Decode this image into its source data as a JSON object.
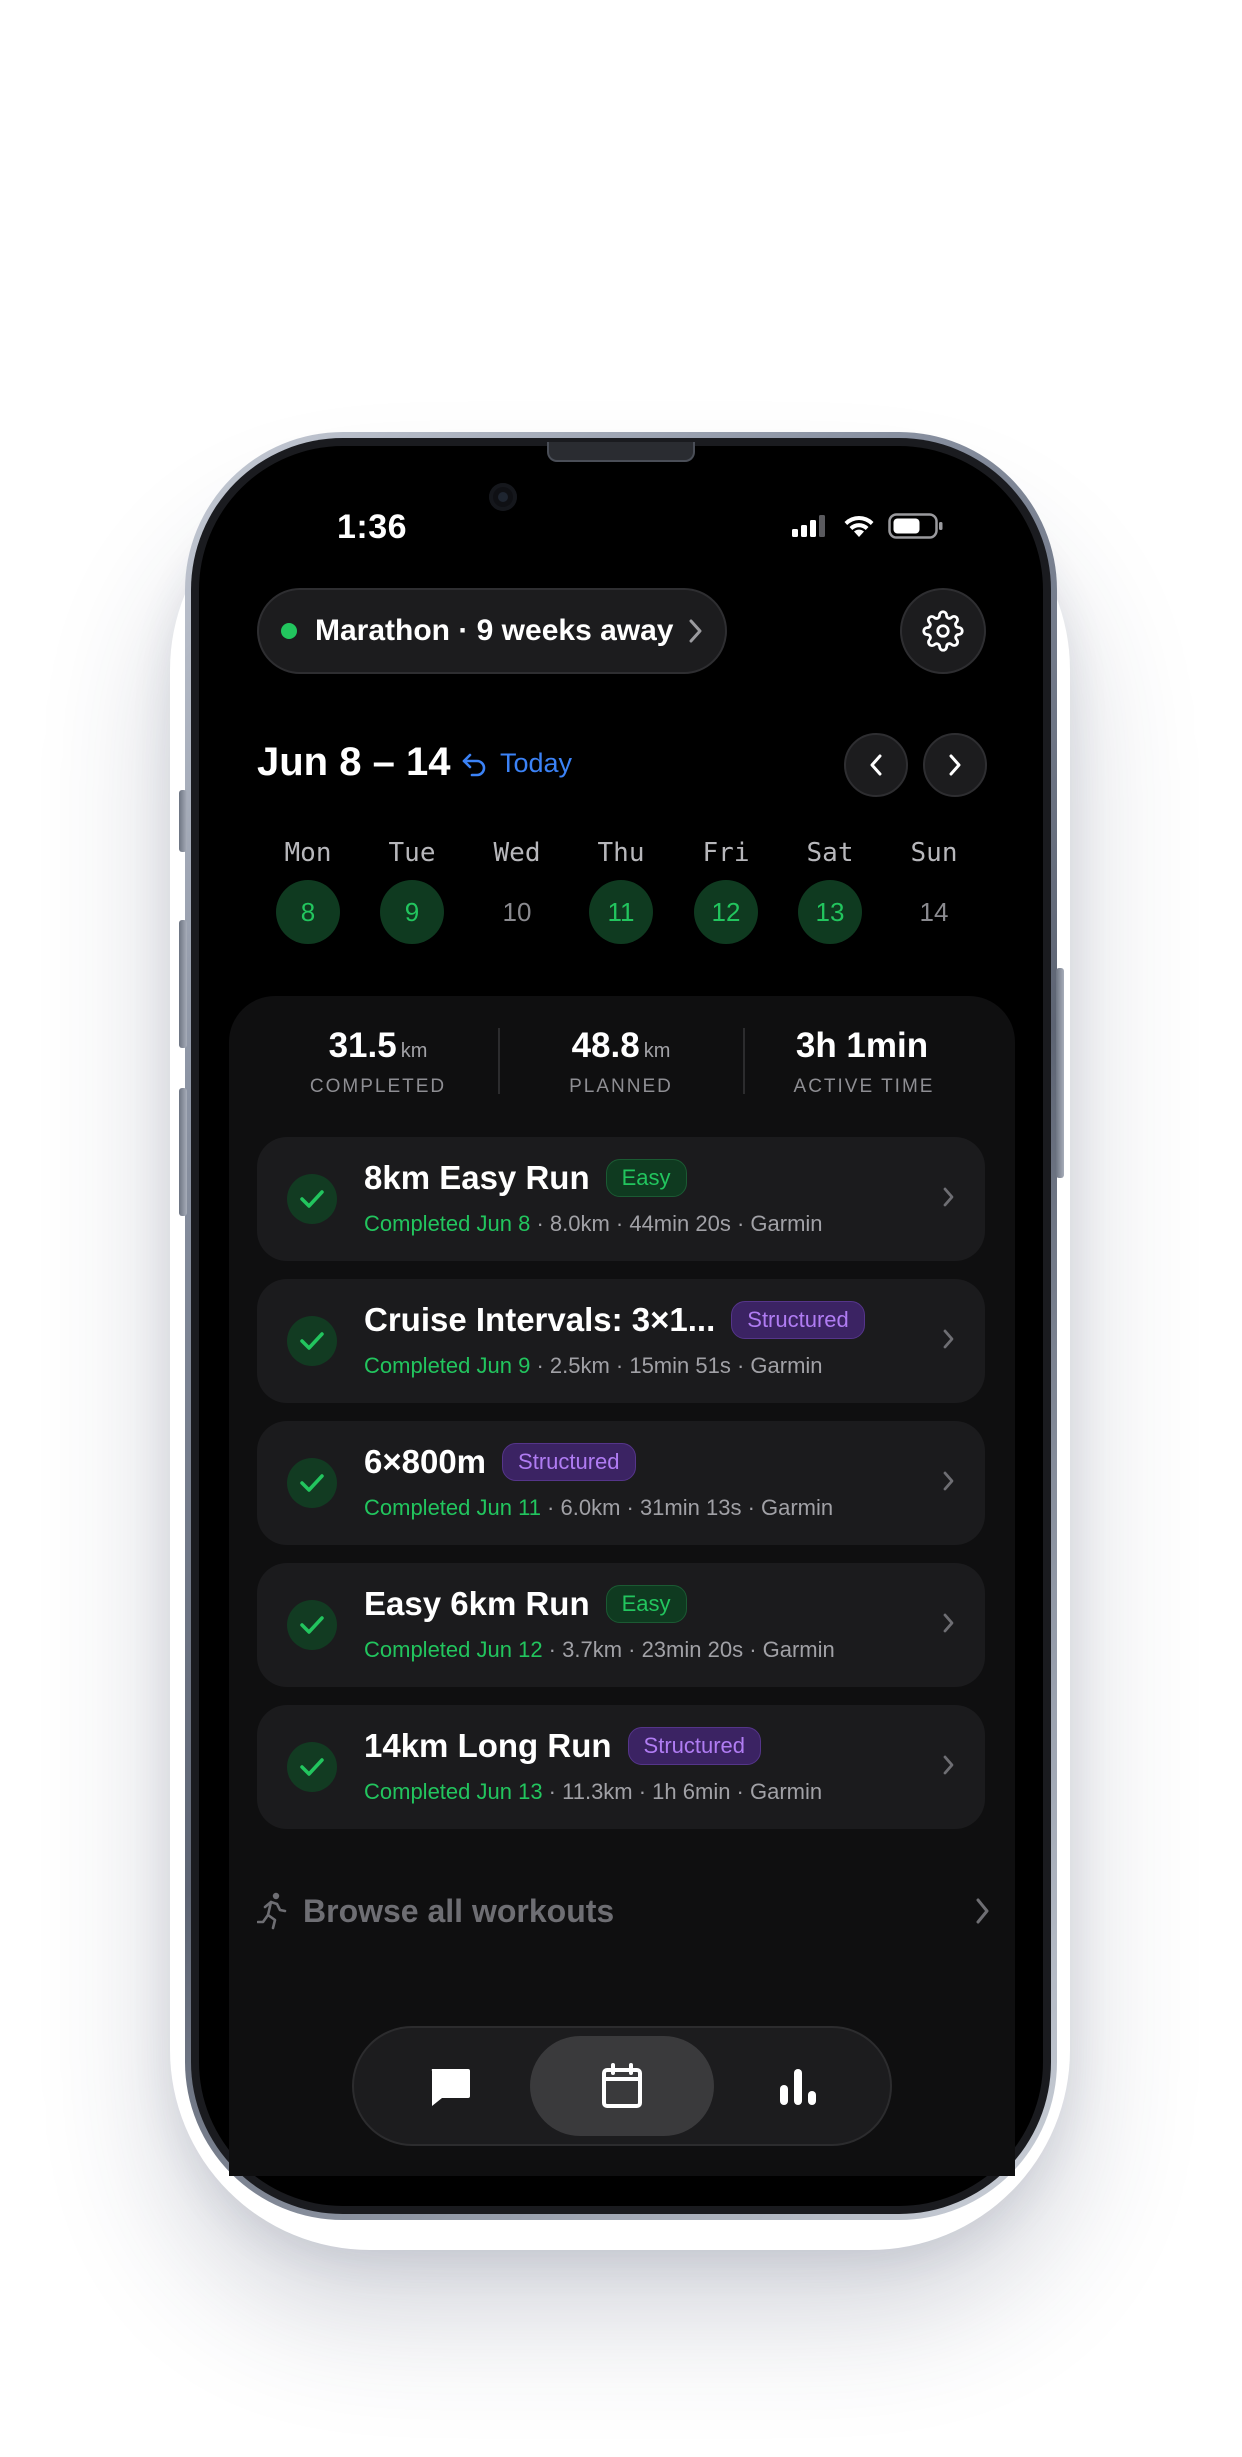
{
  "status_bar": {
    "time": "1:36"
  },
  "header": {
    "race_label": "Marathon · 9 weeks away",
    "settings_icon": "gear-icon"
  },
  "week": {
    "range": "Jun 8 – 14",
    "today_label": "Today",
    "days": [
      {
        "name": "Mon",
        "num": "8",
        "done": true
      },
      {
        "name": "Tue",
        "num": "9",
        "done": true
      },
      {
        "name": "Wed",
        "num": "10",
        "done": false
      },
      {
        "name": "Thu",
        "num": "11",
        "done": true
      },
      {
        "name": "Fri",
        "num": "12",
        "done": true
      },
      {
        "name": "Sat",
        "num": "13",
        "done": true
      },
      {
        "name": "Sun",
        "num": "14",
        "done": false
      }
    ]
  },
  "stats": [
    {
      "value": "31.5",
      "unit": "km",
      "label": "COMPLETED"
    },
    {
      "value": "48.8",
      "unit": "km",
      "label": "PLANNED"
    },
    {
      "value": "3h 1min",
      "unit": "",
      "label": "ACTIVE TIME"
    }
  ],
  "workouts": [
    {
      "title": "8km Easy Run",
      "badge": "Easy",
      "badge_type": "easy",
      "completed": "Completed Jun 8",
      "details": " · 8.0km · 44min 20s · Garmin"
    },
    {
      "title": "Cruise Intervals: 3×1...",
      "badge": "Structured",
      "badge_type": "structured",
      "completed": "Completed Jun 9",
      "details": " · 2.5km · 15min 51s · Garmin"
    },
    {
      "title": "6×800m",
      "badge": "Structured",
      "badge_type": "structured",
      "completed": "Completed Jun 11",
      "details": " · 6.0km · 31min 13s · Garmin"
    },
    {
      "title": "Easy 6km Run",
      "badge": "Easy",
      "badge_type": "easy",
      "completed": "Completed Jun 12",
      "details": " · 3.7km · 23min 20s · Garmin"
    },
    {
      "title": "14km Long Run",
      "badge": "Structured",
      "badge_type": "structured",
      "completed": "Completed Jun 13",
      "details": " · 11.3km · 1h 6min · Garmin"
    }
  ],
  "browse": {
    "label": "Browse all workouts",
    "icon": "runner-icon"
  },
  "tabbar": {
    "tabs": [
      {
        "icon": "chat-icon",
        "active": false
      },
      {
        "icon": "calendar-icon",
        "active": true
      },
      {
        "icon": "bar-chart-icon",
        "active": false
      }
    ]
  },
  "colors": {
    "accent_green": "#22c55e",
    "accent_blue": "#3b82f6",
    "accent_purple": "#b07cf3",
    "background": "#000000"
  }
}
